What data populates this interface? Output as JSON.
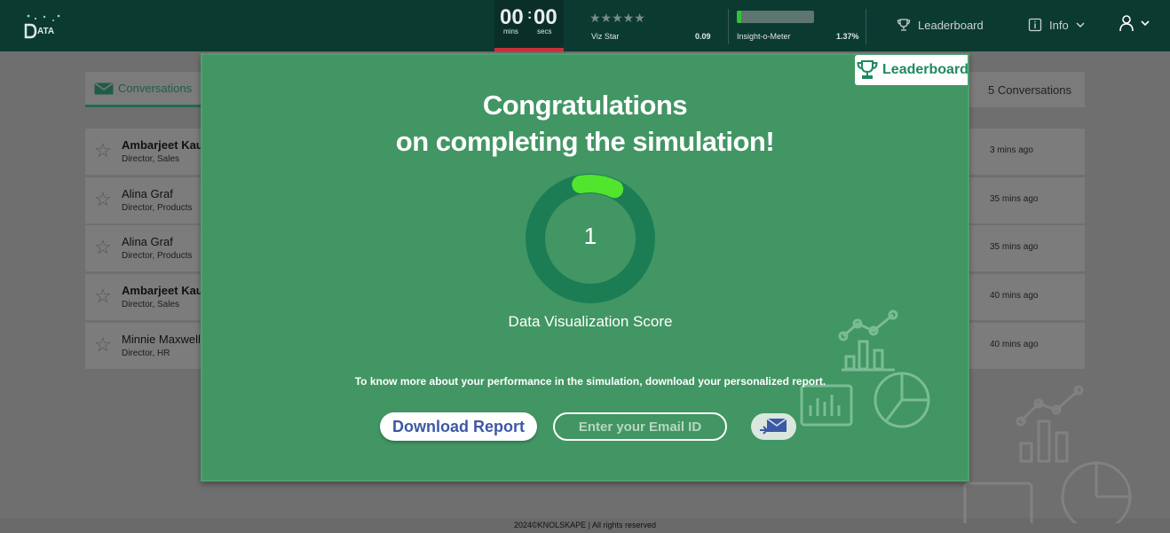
{
  "topbar": {
    "logo_text": "ATA",
    "timer": {
      "minutes": "00",
      "seconds": "00",
      "minutes_label": "mins",
      "seconds_label": "secs"
    },
    "viz_star": {
      "stars": "★★★★★",
      "label": "Viz Star",
      "value": "0.09"
    },
    "insight_meter": {
      "label": "Insight-o-Meter",
      "value": "1.37%",
      "fill_percent": 1.37
    },
    "leaderboard_label": "Leaderboard",
    "info_label": "Info"
  },
  "background": {
    "tab_label": "Conversations",
    "conversation_count": "5 Conversations",
    "rows": [
      {
        "name": "Ambarjeet Kaur",
        "role": "Director, Sales",
        "time": "3 mins ago",
        "bold": true
      },
      {
        "name": "Alina Graf",
        "role": "Director, Products",
        "time": "35 mins ago",
        "bold": false
      },
      {
        "name": "Alina Graf",
        "role": "Director, Products",
        "time": "35 mins ago",
        "bold": false
      },
      {
        "name": "Ambarjeet Kaur",
        "role": "Director, Sales",
        "time": "40 mins ago",
        "bold": true
      },
      {
        "name": "Minnie Maxwell",
        "role": "Director, HR",
        "time": "40 mins ago",
        "bold": false
      }
    ],
    "footer": "2024©KNOLSKAPE | All rights reserved"
  },
  "modal": {
    "leaderboard_button": "Leaderboard",
    "title_line1": "Congratulations",
    "title_line2": "on completing the simulation!",
    "score": "1",
    "score_fraction": 0.1,
    "score_label": "Data Visualization Score",
    "info_text": "To know more about your performance in the simulation, download your personalized report.",
    "download_button": "Download Report",
    "email_placeholder": "Enter your Email ID"
  },
  "colors": {
    "topbar": "#0b3a31",
    "modal_bg": "#419663",
    "ring_track": "#1c7d55",
    "ring_progress": "#52e52d",
    "accent_blue": "#3d58a6"
  }
}
